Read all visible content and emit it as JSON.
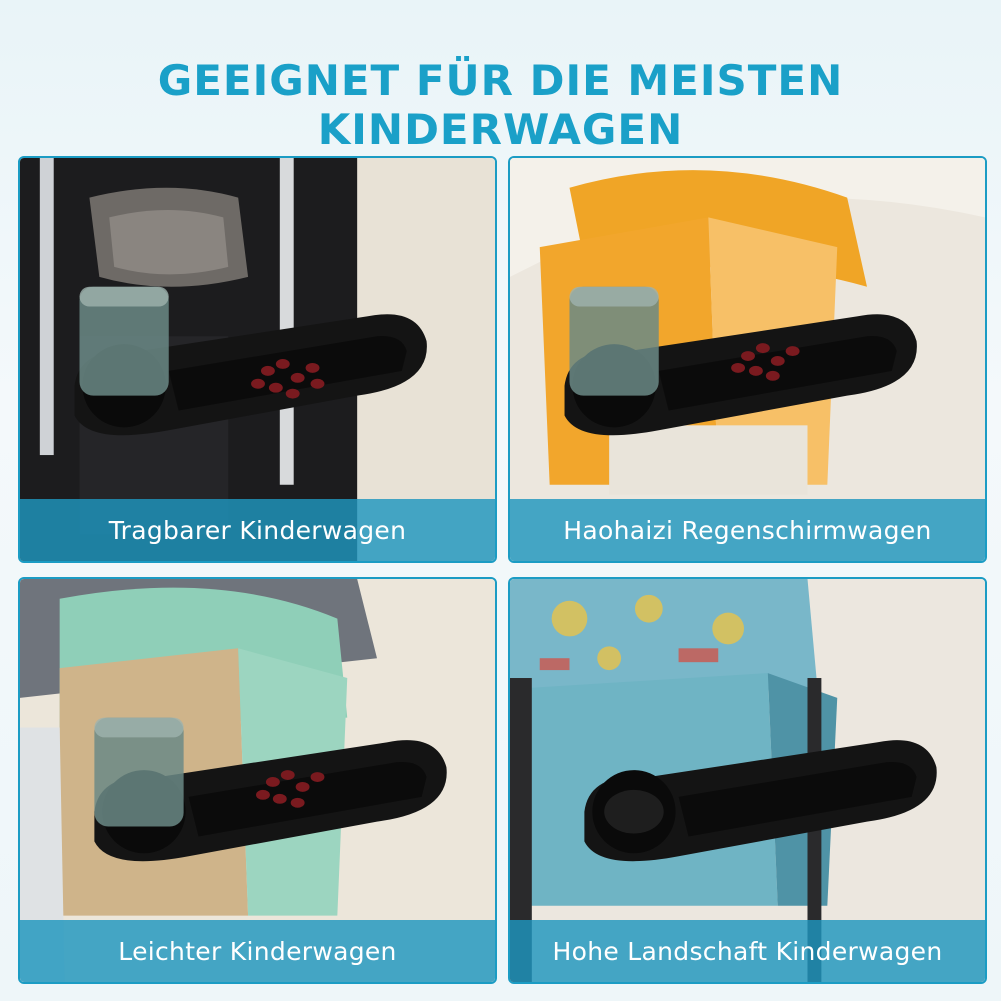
{
  "headline": "GEEIGNET FÜR DIE MEISTEN KINDERWAGEN",
  "panels": [
    {
      "caption": "Tragbarer Kinderwagen"
    },
    {
      "caption": "Haohaizi Regenschirmwagen"
    },
    {
      "caption": "Leichter Kinderwagen"
    },
    {
      "caption": "Hohe Landschaft Kinderwagen"
    }
  ],
  "colors": {
    "accent": "#1aa0c8",
    "caption_bar": "#1e96be",
    "tray": "#151515"
  },
  "icons": [
    "cup-holder-icon",
    "tray-icon"
  ]
}
